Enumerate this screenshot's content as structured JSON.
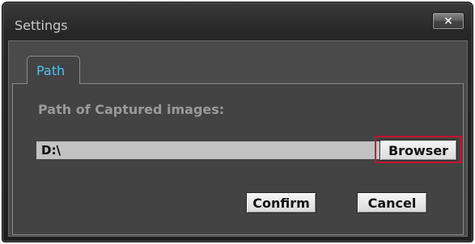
{
  "window": {
    "title": "Settings",
    "close_symbol": "×"
  },
  "tabs": [
    {
      "label": "Path",
      "active": true
    }
  ],
  "path": {
    "label": "Path of Captured images:",
    "value": "D:\\",
    "browse_label": "Browser"
  },
  "actions": {
    "confirm_label": "Confirm",
    "cancel_label": "Cancel"
  },
  "colors": {
    "tab_accent": "#4fc3f7",
    "highlight": "#c8102e"
  }
}
